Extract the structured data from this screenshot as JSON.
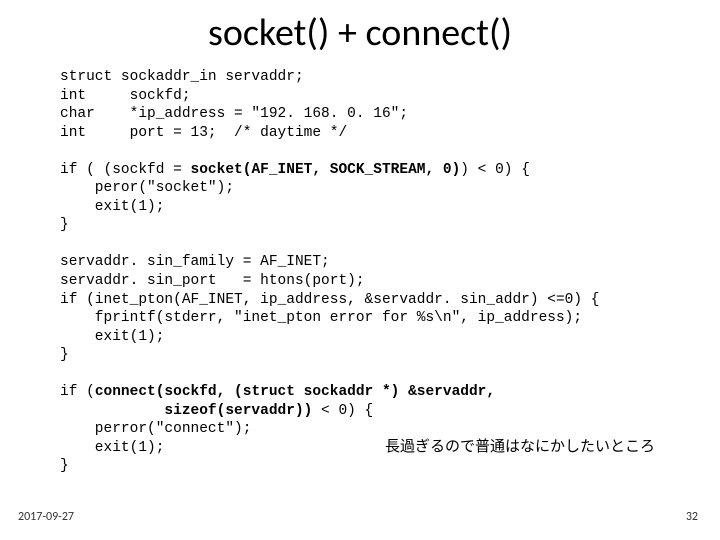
{
  "title": "socket() + connect()",
  "code": {
    "decl1": "struct sockaddr_in servaddr;",
    "decl2": "int     sockfd;",
    "decl3": "char    *ip_address = \"192. 168. 0. 16\";",
    "decl4": "int     port = 13;  /* daytime */",
    "if1_a": "if ( (sockfd = ",
    "if1_b": "socket(AF_INET, SOCK_STREAM, 0)",
    "if1_c": ") < 0) {",
    "if1_body1": "    peror(\"socket\");",
    "if1_body2": "    exit(1);",
    "if1_end": "}",
    "assign1": "servaddr. sin_family = AF_INET;",
    "assign2": "servaddr. sin_port   = htons(port);",
    "if2": "if (inet_pton(AF_INET, ip_address, &servaddr. sin_addr) <=0) {",
    "if2_body1": "    fprintf(stderr, \"inet_pton error for %s\\n\", ip_address);",
    "if2_body2": "    exit(1);",
    "if2_end": "}",
    "if3_a": "if (",
    "if3_b": "connect(sockfd, (struct sockaddr *) &servaddr,",
    "if3_b2": "            sizeof(servaddr))",
    "if3_c": " < 0) {",
    "if3_body1": "    perror(\"connect\");",
    "if3_body2": "    exit(1);",
    "if3_end": "}"
  },
  "annotation": "長過ぎるので普通はなにかしたいところ",
  "date": "2017-09-27",
  "page": "32"
}
